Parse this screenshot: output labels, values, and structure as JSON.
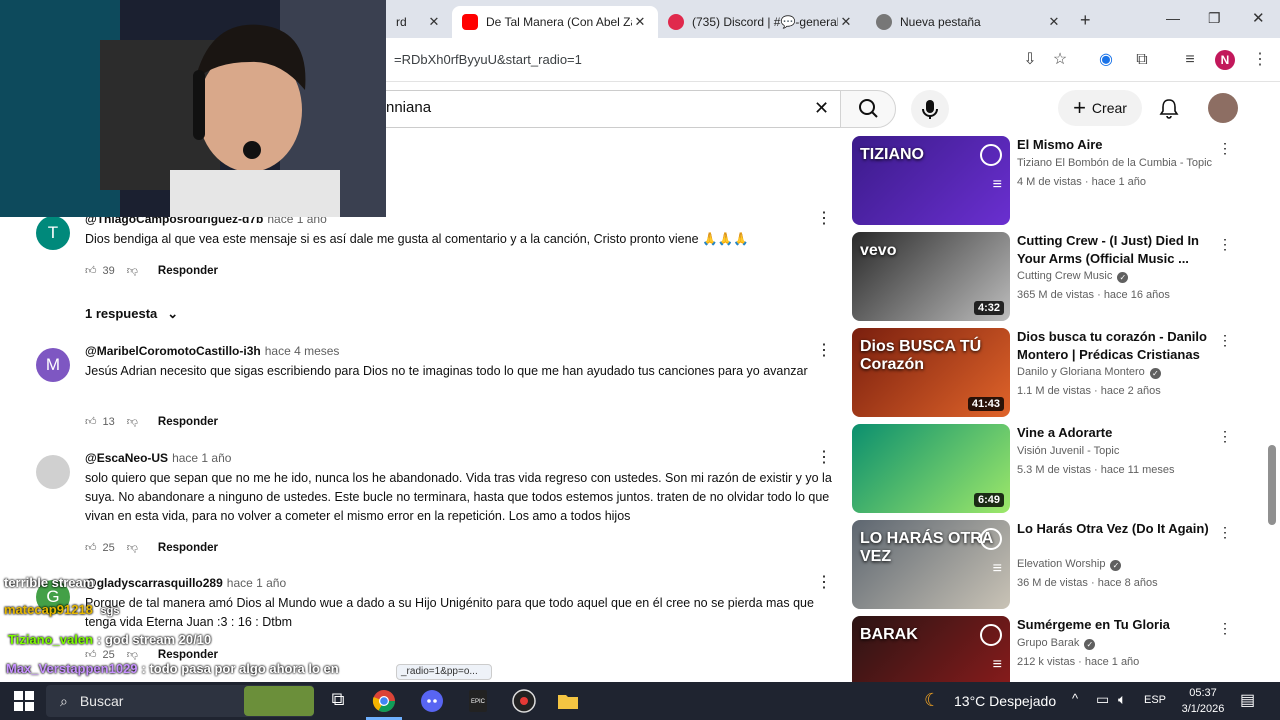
{
  "browser": {
    "tabs": [
      {
        "title": "rd",
        "favicon_color": "#ff0000"
      },
      {
        "title": "De Tal Manera (Con Abel Za",
        "favicon_color": "#ff0000"
      },
      {
        "title": "(735) Discord | #💬-general",
        "favicon_color": "#5865f2",
        "badge": "735"
      },
      {
        "title": "Nueva pestaña",
        "favicon_color": "#555555"
      }
    ],
    "url": "=RDbXh0rfByyuU&start_radio=1",
    "profile_initial": "N",
    "profile_color": "#c2185b"
  },
  "youtube": {
    "search_value": "nniana",
    "create_label": "Crear"
  },
  "comments": [
    {
      "user": "@ThiagoCamposrodriguez-d7b",
      "time": "hace 1 año",
      "avatar_letter": "T",
      "avatar_color": "#00897b",
      "text": "Dios bendiga al que vea este mensaje si es así dale me gusta al comentario y a la canción, Cristo pronto viene 🙏🙏🙏",
      "likes": "39",
      "reply_label": "Responder",
      "replies_label": "1 respuesta"
    },
    {
      "user": "@MaribelCoromotoCastillo-i3h",
      "time": "hace 4 meses",
      "avatar_letter": "M",
      "avatar_color": "#7e57c2",
      "text": "Jesús Adrian necesito que sigas escribiendo para Dios no te imaginas todo lo que me han ayudado tus canciones para yo avanzar",
      "likes": "13",
      "reply_label": "Responder"
    },
    {
      "user": "@EscaNeo-US",
      "time": "hace 1 año",
      "avatar_letter": "",
      "avatar_color": "#b0b0b0",
      "text": "solo quiero que sepan que no me he ido, nunca los he abandonado. Vida tras vida regreso con ustedes. Son mi razón de existir y yo la suya. No abandonare a ninguno de ustedes. Este bucle no terminara, hasta que todos estemos juntos. traten de no olvidar todo lo que vivan en esta vida, para no volver a cometer el mismo error en la repetición. Los amo a todos hijos",
      "likes": "25",
      "reply_label": "Responder"
    },
    {
      "user": "@gladyscarrasquillo289",
      "time": "hace 1 año",
      "avatar_letter": "G",
      "avatar_color": "#43a047",
      "text": "Porque de tal manera amó Dios al Mundo wue a dado a su Hijo Unigénito para que todo aquel que en él cree no se pierda mas que tenga vida Eterna Juan :3 : 16 : Dtbm",
      "likes": "25",
      "reply_label": "Responder"
    }
  ],
  "sidebar_videos": [
    {
      "title": "El Mismo Aire",
      "channel": "Tiziano El Bombón de la Cumbia - Topic",
      "verified": false,
      "meta": "4 M de vistas · hace 1 año",
      "duration": "",
      "colors": [
        "#3b1b8a",
        "#6a2fd0"
      ],
      "thumb_text": "TIZIANO"
    },
    {
      "title": "Cutting Crew - (I Just) Died In Your Arms (Official Music ...",
      "channel": "Cutting Crew Music",
      "verified": true,
      "meta": "365 M de vistas · hace 16 años",
      "duration": "4:32",
      "colors": [
        "#2a2a2a",
        "#bdbdbd"
      ],
      "thumb_text": "vevo"
    },
    {
      "title": "Dios busca tu corazón - Danilo Montero | Prédicas Cristianas",
      "channel": "Danilo y Gloriana Montero",
      "verified": true,
      "meta": "1.1 M de vistas · hace 2 años",
      "duration": "41:43",
      "colors": [
        "#7a1f0e",
        "#e0642a"
      ],
      "thumb_text": "Dios BUSCA TÚ Corazón"
    },
    {
      "title": "Vine a Adorarte",
      "channel": "Visión Juvenil - Topic",
      "verified": false,
      "meta": "5.3 M de vistas · hace 11 meses",
      "duration": "6:49",
      "colors": [
        "#0b8f6e",
        "#9ee86a"
      ],
      "thumb_text": ""
    },
    {
      "title": "Lo Harás Otra Vez (Do It Again)",
      "channel": "Elevation Worship",
      "verified": true,
      "meta": "36 M de vistas · hace 8 años",
      "duration": "",
      "colors": [
        "#5d6670",
        "#c9c3b6"
      ],
      "thumb_text": "LO HARÁS OTRA VEZ"
    },
    {
      "title": "Sumérgeme en Tu Gloria",
      "channel": "Grupo Barak",
      "verified": true,
      "meta": "212 k vistas · hace 1 año",
      "duration": "",
      "colors": [
        "#2b1414",
        "#8e1c1c"
      ],
      "thumb_text": "BARAK"
    }
  ],
  "stream_chat": [
    {
      "user": "terrible stream",
      "text": "",
      "color": "#ffffff"
    },
    {
      "user": "matecap91218",
      "text": "sgs",
      "color": "#e6b800"
    },
    {
      "user": "Tiziano_valen",
      "text": ": god stream 20/10",
      "color": "#7cfc00"
    },
    {
      "user": "Max_Verstappen1029",
      "text": ": todo pasa por algo ahora lo en",
      "color": "#c792ff"
    }
  ],
  "status_url_fragment": "_radio=1&pp=o...",
  "taskbar": {
    "search_placeholder": "Buscar",
    "weather": "13°C  Despejado",
    "language": "ESP",
    "time": "05:37",
    "date": "3/1/2026"
  }
}
